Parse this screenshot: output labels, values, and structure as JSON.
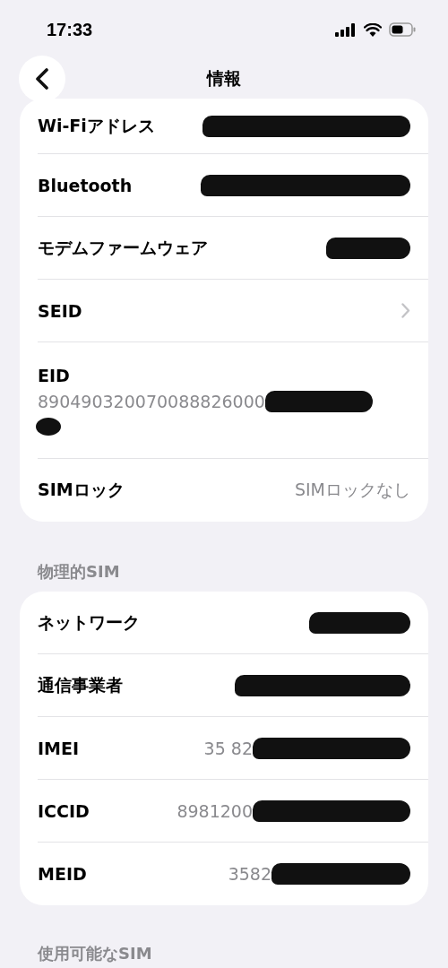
{
  "status_bar": {
    "time": "17:33"
  },
  "nav": {
    "title": "情報"
  },
  "sections": [
    {
      "rows": [
        {
          "kind": "value",
          "label": "Wi-Fiアドレス",
          "redacted": true
        },
        {
          "kind": "value",
          "label": "Bluetooth",
          "redacted": true
        },
        {
          "kind": "value",
          "label": "モデムファームウェア",
          "redacted": true
        },
        {
          "kind": "chevron",
          "label": "SEID"
        },
        {
          "kind": "stacked",
          "label": "EID",
          "value": "890490320070088826000",
          "redacted": true
        },
        {
          "kind": "value",
          "label": "SIMロック",
          "value": "SIMロックなし",
          "redacted": false
        }
      ]
    },
    {
      "header": "物理的SIM",
      "rows": [
        {
          "kind": "value",
          "label": "ネットワーク",
          "redacted": true
        },
        {
          "kind": "value",
          "label": "通信事業者",
          "redacted": true
        },
        {
          "kind": "value",
          "label": "IMEI",
          "value": "35 82",
          "redacted": true
        },
        {
          "kind": "value",
          "label": "ICCID",
          "value": "8981200",
          "redacted": true
        },
        {
          "kind": "value",
          "label": "MEID",
          "value": "3582",
          "redacted": true
        }
      ]
    },
    {
      "header": "使用可能なSIM"
    }
  ]
}
